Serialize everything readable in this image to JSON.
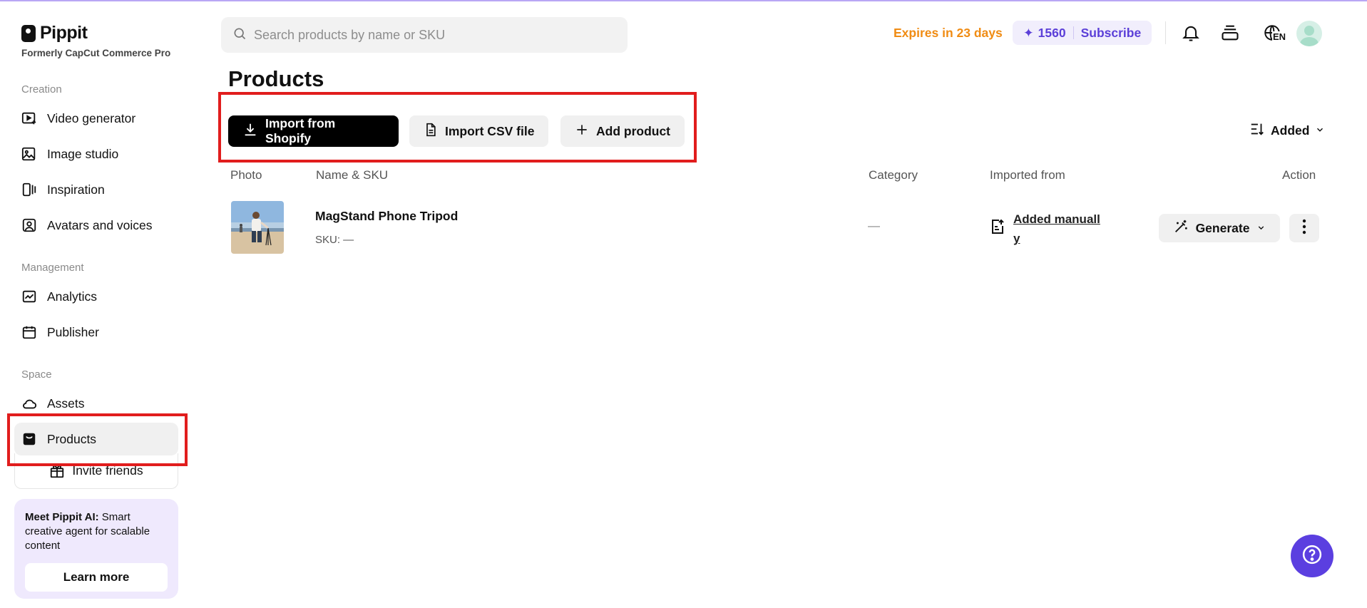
{
  "brand": {
    "name": "Pippit",
    "subtitle": "Formerly CapCut Commerce Pro"
  },
  "sidebar": {
    "sections": [
      {
        "label": "Creation",
        "items": [
          {
            "label": "Video generator",
            "icon": "video-generator-icon"
          },
          {
            "label": "Image studio",
            "icon": "image-studio-icon"
          },
          {
            "label": "Inspiration",
            "icon": "inspiration-icon"
          },
          {
            "label": "Avatars and voices",
            "icon": "avatar-icon"
          }
        ]
      },
      {
        "label": "Management",
        "items": [
          {
            "label": "Analytics",
            "icon": "analytics-icon"
          },
          {
            "label": "Publisher",
            "icon": "calendar-icon"
          }
        ]
      },
      {
        "label": "Space",
        "items": [
          {
            "label": "Assets",
            "icon": "cloud-icon"
          },
          {
            "label": "Products",
            "icon": "product-bag-icon",
            "active": true
          }
        ]
      }
    ],
    "invite_label": "Invite friends",
    "promo": {
      "bold": "Meet Pippit AI:",
      "text": " Smart creative agent for scalable content",
      "button": "Learn more"
    }
  },
  "topbar": {
    "search_placeholder": "Search products by name or SKU",
    "expires": "Expires in 23 days",
    "credits": "1560",
    "subscribe": "Subscribe",
    "language": "EN"
  },
  "main": {
    "title": "Products",
    "actions": {
      "import_shopify": "Import from Shopify",
      "import_csv": "Import CSV file",
      "add_product": "Add product"
    },
    "sort_label": "Added",
    "columns": {
      "photo": "Photo",
      "name_sku": "Name & SKU",
      "category": "Category",
      "imported_from": "Imported from",
      "action": "Action"
    },
    "rows": [
      {
        "name": "MagStand Phone Tripod",
        "sku": "SKU: —",
        "category": "—",
        "imported_from": "Added manually",
        "generate": "Generate"
      }
    ]
  },
  "colors": {
    "accent": "#5b3fe0",
    "warning": "#f08c14",
    "highlight": "#e11d1d"
  }
}
